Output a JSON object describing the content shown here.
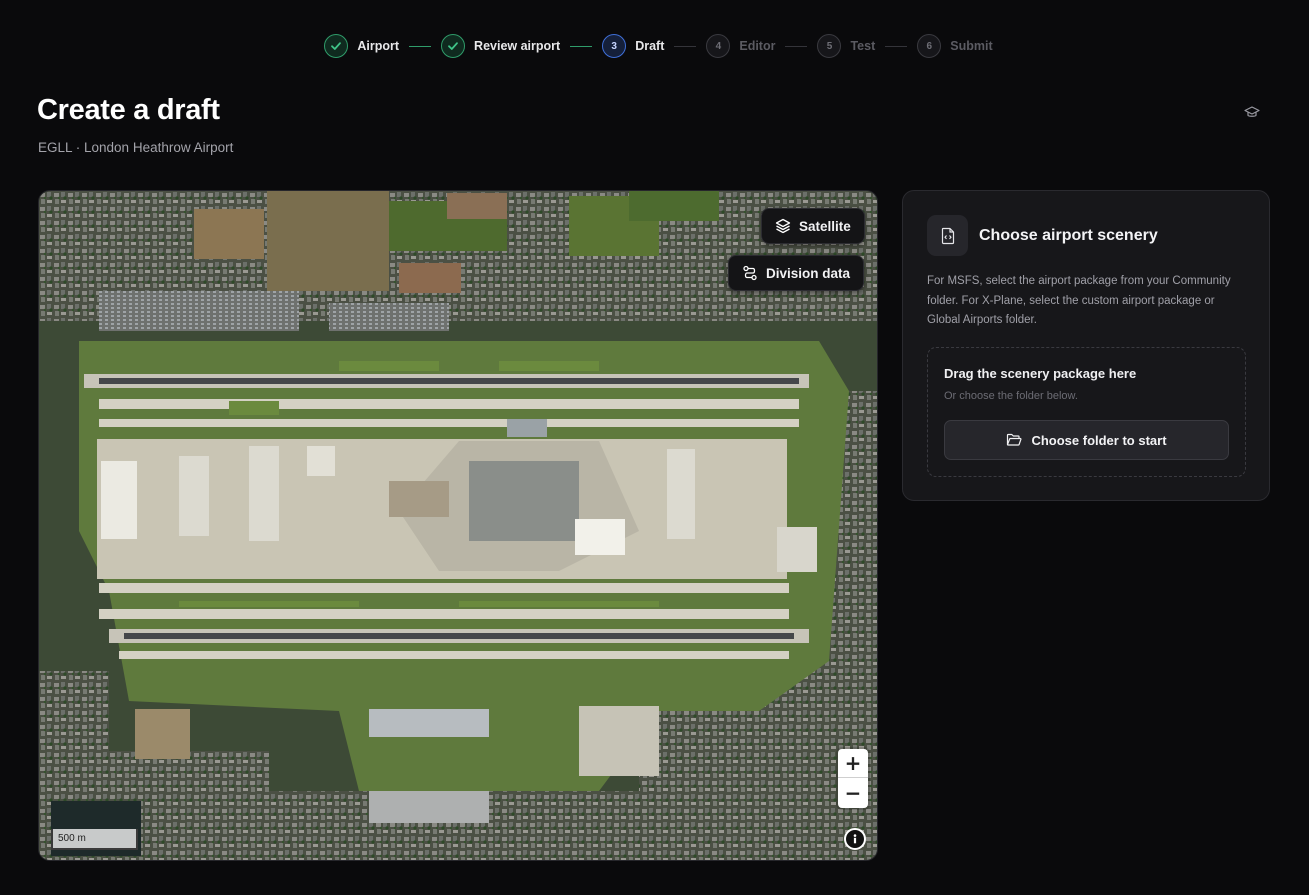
{
  "stepper": {
    "steps": [
      {
        "number": "1",
        "label": "Airport",
        "state": "done"
      },
      {
        "number": "2",
        "label": "Review airport",
        "state": "done"
      },
      {
        "number": "3",
        "label": "Draft",
        "state": "active"
      },
      {
        "number": "4",
        "label": "Editor",
        "state": "todo"
      },
      {
        "number": "5",
        "label": "Test",
        "state": "todo"
      },
      {
        "number": "6",
        "label": "Submit",
        "state": "todo"
      }
    ]
  },
  "header": {
    "title": "Create a draft",
    "subtitle": "EGLL · London Heathrow Airport",
    "help_icon": "graduation-cap-icon"
  },
  "map": {
    "layer_button": "Satellite",
    "division_button": "Division data",
    "zoom_in": "+",
    "zoom_out": "−",
    "scale_label": "500 m"
  },
  "panel": {
    "title": "Choose airport scenery",
    "description": "For MSFS, select the airport package from your Community folder. For X-Plane, select the custom airport package or Global Airports folder.",
    "dropzone": {
      "title": "Drag the scenery package here",
      "subtitle": "Or choose the folder below.",
      "button": "Choose folder to start"
    }
  },
  "colors": {
    "background": "#0a0a0c",
    "panel": "#17171a",
    "success": "#2f9c6a",
    "active": "#3f6fd8"
  }
}
